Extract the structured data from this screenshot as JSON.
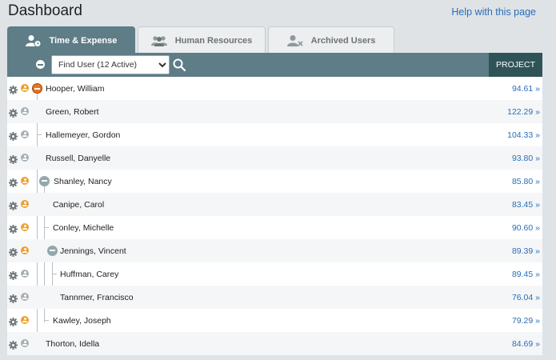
{
  "header": {
    "title": "Dashboard",
    "help_link": "Help with this page"
  },
  "tabs": [
    {
      "label": "Time & Expense",
      "icon": "user-clock-icon",
      "active": true
    },
    {
      "label": "Human Resources",
      "icon": "users-icon",
      "active": false
    },
    {
      "label": "Archived Users",
      "icon": "user-remove-icon",
      "active": false
    }
  ],
  "toolbar": {
    "find_user_selected": "Find User (12 Active)",
    "project_column": "PROJECT"
  },
  "colors": {
    "accent": "#5e7d86",
    "project_header": "#2f5458",
    "link": "#2a6db8",
    "orange": "#f0a02a"
  },
  "rows": [
    {
      "name": "Hooper, William",
      "value": "94.61 »",
      "avatar": "orange",
      "toggle": "orange"
    },
    {
      "name": "Green, Robert",
      "value": "122.29 »",
      "avatar": "gray"
    },
    {
      "name": "Hallemeyer, Gordon",
      "value": "104.33 »",
      "avatar": "gray"
    },
    {
      "name": "Russell, Danyelle",
      "value": "93.80 »",
      "avatar": "gray"
    },
    {
      "name": "Shanley, Nancy",
      "value": "85.80 »",
      "avatar": "orange",
      "toggle": "gray"
    },
    {
      "name": "Canipe, Carol",
      "value": "83.45 »",
      "avatar": "orange"
    },
    {
      "name": "Conley, Michelle",
      "value": "90.60 »",
      "avatar": "orange"
    },
    {
      "name": "Jennings, Vincent",
      "value": "89.39 »",
      "avatar": "orange",
      "toggle": "gray"
    },
    {
      "name": "Huffman, Carey",
      "value": "89.45 »",
      "avatar": "gray"
    },
    {
      "name": "Tannmer, Francisco",
      "value": "76.04 »",
      "avatar": "gray"
    },
    {
      "name": "Kawley, Joseph",
      "value": "79.29 »",
      "avatar": "orange"
    },
    {
      "name": "Thorton, Idella",
      "value": "84.69 »",
      "avatar": "gray"
    }
  ]
}
